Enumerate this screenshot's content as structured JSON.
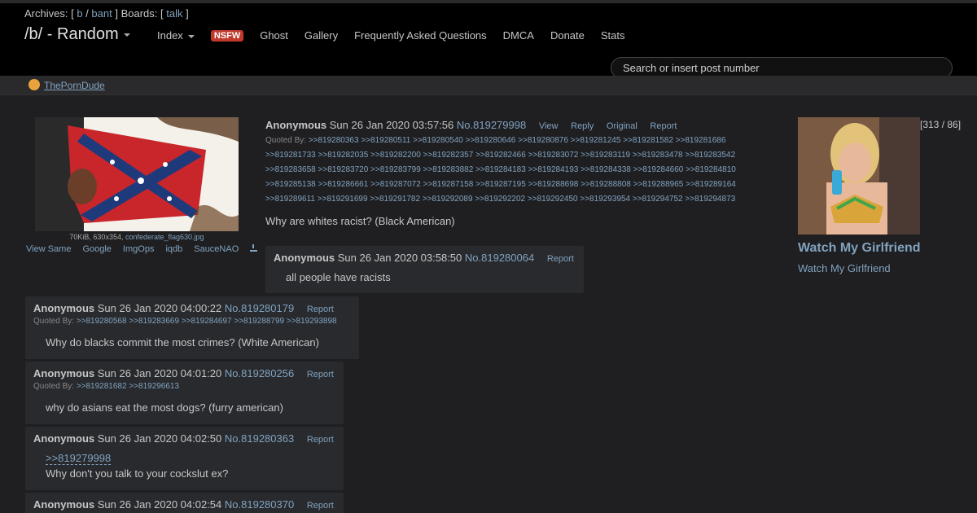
{
  "archives": {
    "label": "Archives: [",
    "boards_label": "] Boards: [",
    "end": "]",
    "sep": "/",
    "links": [
      "b",
      "bant"
    ],
    "boards": [
      "talk"
    ]
  },
  "board": {
    "title": "/b/ - Random"
  },
  "nav": {
    "index": "Index",
    "nsfw": "NSFW",
    "items": [
      "Ghost",
      "Gallery",
      "Frequently Asked Questions",
      "DMCA",
      "Donate",
      "Stats"
    ]
  },
  "search": {
    "placeholder": "Search or insert post number"
  },
  "sponsor": {
    "label": "ThePornDude"
  },
  "op": {
    "file_size": "70KiB, 630x354,",
    "filename": "confederate_flag630.jpg",
    "tools": [
      "View Same",
      "Google",
      "ImgOps",
      "iqdb",
      "SauceNAO"
    ],
    "name": "Anonymous",
    "date": "Sun 26 Jan 2020 03:57:56",
    "number": "No.819279998",
    "controls": [
      "View",
      "Reply",
      "Original",
      "Report"
    ],
    "quoted_label": "Quoted By:",
    "quoted_by": [
      ">>819280363",
      ">>819280511",
      ">>819280540",
      ">>819280646",
      ">>819280876",
      ">>819281245",
      ">>819281582",
      ">>819281686",
      ">>819281733",
      ">>819282035",
      ">>819282200",
      ">>819282357",
      ">>819282466",
      ">>819283072",
      ">>819283119",
      ">>819283478",
      ">>819283542",
      ">>819283658",
      ">>819283720",
      ">>819283799",
      ">>819283882",
      ">>819284183",
      ">>819284193",
      ">>819284338",
      ">>819284660",
      ">>819284810",
      ">>819285138",
      ">>819286661",
      ">>819287072",
      ">>819287158",
      ">>819287195",
      ">>819288698",
      ">>819288808",
      ">>819288965",
      ">>819289164",
      ">>819289611",
      ">>819291699",
      ">>819291782",
      ">>819292089",
      ">>819292202",
      ">>819292450",
      ">>819293954",
      ">>819294752",
      ">>819294873"
    ],
    "message": "Why are whites racist? (Black American)",
    "counter": "[313 / 86]"
  },
  "ad": {
    "title": "Watch My Girlfriend",
    "subtitle": "Watch My Girlfriend"
  },
  "replies": [
    {
      "name": "Anonymous",
      "date": "Sun 26 Jan 2020 03:58:50",
      "number": "No.819280064",
      "report": "Report",
      "quoted_by": "",
      "quotelink": "",
      "message": "all people have racists"
    },
    {
      "name": "Anonymous",
      "date": "Sun 26 Jan 2020 04:00:22",
      "number": "No.819280179",
      "report": "Report",
      "quoted_label": "Quoted By:",
      "quoted_by": ">>819280568 >>819283669 >>819284697 >>819288799 >>819293898",
      "quotelink": "",
      "message": "Why do blacks commit the most crimes? (White American)"
    },
    {
      "name": "Anonymous",
      "date": "Sun 26 Jan 2020 04:01:20",
      "number": "No.819280256",
      "report": "Report",
      "quoted_label": "Quoted By:",
      "quoted_by": ">>819281682 >>819296613",
      "quotelink": "",
      "message": "why do asians eat the most dogs? (furry american)"
    },
    {
      "name": "Anonymous",
      "date": "Sun 26 Jan 2020 04:02:50",
      "number": "No.819280363",
      "report": "Report",
      "quoted_by": "",
      "quotelink": ">>819279998",
      "message": "Why don't you talk to your cockslut ex?"
    },
    {
      "name": "Anonymous",
      "date": "Sun 26 Jan 2020 04:02:54",
      "number": "No.819280370",
      "report": "Report",
      "quoted_by": "",
      "quotelink": "",
      "message": ""
    }
  ]
}
